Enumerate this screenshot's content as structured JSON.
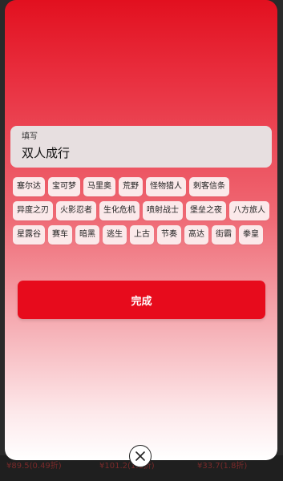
{
  "input": {
    "label": "填写",
    "value": "双人成行"
  },
  "tags": [
    "塞尔达",
    "宝可梦",
    "马里奥",
    "荒野",
    "怪物猎人",
    "刺客信条",
    "异度之刃",
    "火影忍者",
    "生化危机",
    "喷射战士",
    "堡垒之夜",
    "八方旅人",
    "星露谷",
    "赛车",
    "暗黑",
    "逃生",
    "上古",
    "节奏",
    "高达",
    "街霸",
    "拳皇"
  ],
  "done_button": {
    "label": "完成"
  },
  "close_button": {
    "icon": "close-icon"
  },
  "background": {
    "prices": [
      "¥89.5(0.49折)",
      "¥101.2(1.1折)",
      "¥33.7(1.8折)"
    ]
  },
  "colors": {
    "accent": "#e70b1c",
    "tag_bg": "#fbe9ea"
  }
}
